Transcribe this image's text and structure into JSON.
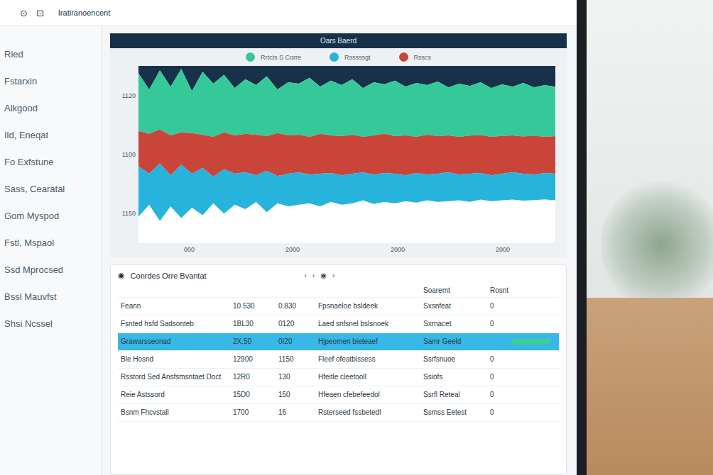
{
  "window": {
    "title": "Iratiranoencent",
    "icons": [
      "⊙",
      "⊡"
    ]
  },
  "dashboard": {
    "title": "Oars Baerd"
  },
  "sidebar": {
    "items": [
      "Ried",
      "Fstarxin",
      "Alkgood",
      "Ild, Eneqat",
      "Fo Exfstune",
      "Sass, Cearatal",
      "Gom Myspod",
      "Fstl, Mspaol",
      "Ssd Mprocsed",
      "Bssl Mauvfst",
      "Shsi Ncssel"
    ]
  },
  "chart": {
    "legend": [
      {
        "label": "Rrtcts S Corre",
        "color": "#35c99a"
      },
      {
        "label": "Rsssssgt",
        "color": "#26b3dc"
      },
      {
        "label": "Rsscs",
        "color": "#c9453a"
      }
    ],
    "y_ticks": [
      "1120",
      "1100",
      "1150"
    ],
    "x_ticks": [
      "000",
      "2000",
      "2000",
      "2000"
    ],
    "y_max": 1200,
    "series": [
      {
        "name": "Rrtcts S Corre",
        "color": "#35c99a",
        "values": [
          1150,
          1040,
          1170,
          1060,
          1180,
          1030,
          1160,
          1080,
          1140,
          1050,
          1110,
          1070,
          1130,
          1040,
          1090,
          1080,
          1120,
          1060,
          1100,
          1070,
          1110,
          1050,
          1090,
          1075,
          1100,
          1060,
          1085,
          1070,
          1095,
          1055,
          1080,
          1065,
          1090,
          1050,
          1075,
          1060,
          1085,
          1055,
          1070,
          1060
        ]
      },
      {
        "name": "Rsscs",
        "color": "#c9453a",
        "values": [
          760,
          740,
          770,
          730,
          750,
          745,
          735,
          720,
          750,
          730,
          740,
          735,
          725,
          745,
          730,
          735,
          720,
          740,
          730,
          725,
          735,
          720,
          730,
          740,
          725,
          730,
          720,
          735,
          725,
          730,
          720,
          728,
          732,
          720,
          726,
          730,
          722,
          728,
          720,
          725
        ]
      },
      {
        "name": "Rsssssgt",
        "color": "#26b3dc",
        "values": [
          520,
          470,
          540,
          460,
          530,
          470,
          510,
          450,
          500,
          470,
          480,
          460,
          490,
          455,
          470,
          480,
          465,
          470,
          475,
          460,
          470,
          480,
          465,
          475,
          470,
          460,
          475,
          465,
          470,
          480,
          465,
          470,
          475,
          460,
          470,
          480,
          470,
          465,
          475,
          470
        ],
        "floor": [
          180,
          260,
          150,
          250,
          170,
          240,
          190,
          270,
          200,
          260,
          230,
          280,
          210,
          270,
          250,
          260,
          270,
          250,
          280,
          260,
          270,
          290,
          265,
          280,
          270,
          285,
          275,
          290,
          280,
          285,
          290,
          280,
          295,
          285,
          290,
          295,
          288,
          292,
          296,
          290
        ]
      }
    ]
  },
  "table": {
    "icon": "◉",
    "title": "Conrdes Orre Bvantat",
    "pager": [
      "‹",
      "‹",
      "◉",
      "›"
    ],
    "columns": [
      "",
      "",
      "",
      "",
      "Soaremt",
      "Rosnt"
    ],
    "rows": [
      {
        "cells": [
          "Feann",
          "10 530",
          "0.830",
          "Fpsnaeloe bsldeek",
          "Sxsnfeat",
          "0"
        ],
        "selected": false,
        "level": 0
      },
      {
        "cells": [
          "Fsnted hsfd Sadsonteb",
          "1BL30",
          "0120",
          "Laed snfsnel bslsnoek",
          "Sxrnacet",
          "0"
        ],
        "selected": false,
        "level": 0
      },
      {
        "cells": [
          "Grawarsseonad",
          "2X.50",
          "0I20",
          "Hjpeomen bieteaef",
          "Samr Geeld",
          ""
        ],
        "selected": true,
        "level": 0.85
      },
      {
        "cells": [
          "Ble Hosnd",
          "12900",
          "1150",
          "Fleef ofeatbissess",
          "Ssrfsnuoe",
          "0"
        ],
        "selected": false,
        "level": 0
      },
      {
        "cells": [
          "Rsstord Sed Ansfsmsntaet Doct",
          "12R0",
          "130",
          "Hfeitle cleetooll",
          "Ssiofs",
          "0"
        ],
        "selected": false,
        "level": 0
      },
      {
        "cells": [
          "Reie Astssord",
          "15D0",
          "150",
          "Hfeaen cfebefeedol",
          "Ssrfl Reteal",
          "0"
        ],
        "selected": false,
        "level": 0
      },
      {
        "cells": [
          "Bsnm Fhcvstall",
          "1700",
          "16",
          "Rsterseed fssbetedl",
          "Ssmss Eetest",
          "0"
        ],
        "selected": false,
        "level": 0
      }
    ]
  }
}
